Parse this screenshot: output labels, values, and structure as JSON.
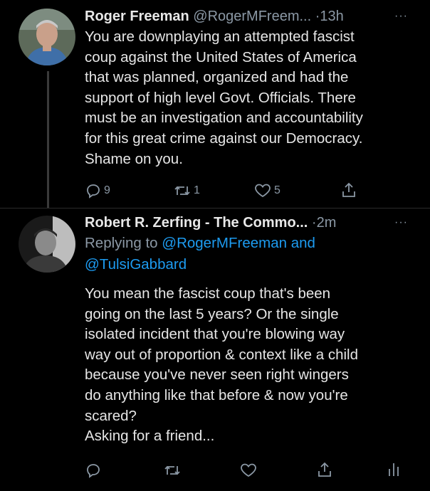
{
  "tweets": [
    {
      "author_name": "Roger Freeman",
      "handle": "@RogerMFreem...",
      "dot": "·",
      "time": "13h",
      "more": "···",
      "lines": [
        "You are downplaying an attempted fascist",
        "coup against the United States of America",
        "that was planned, organized and had the",
        "support of high level Govt. Officials.  There",
        "must be an investigation and accountability",
        "for this great crime against our Democracy.",
        "Shame on you."
      ],
      "actions": {
        "replies": "9",
        "retweets": "1",
        "likes": "5"
      }
    },
    {
      "author_name": "Robert R. Zerfing - The Commo...",
      "dot": "·",
      "time": "2m",
      "more": "···",
      "reply_prefix": "Replying to ",
      "reply_mention_1": "@RogerMFreeman and",
      "reply_mention_2": "@TulsiGabbard",
      "lines": [
        "You mean the fascist coup that's been",
        "going on the last 5 years? Or the single",
        "isolated incident that you're blowing way",
        "way out of proportion & context like a child",
        "because you've never seen right wingers",
        "do anything like that before & now you're",
        "scared?",
        "Asking for a friend..."
      ]
    }
  ],
  "icons": {
    "reply": "reply-icon",
    "retweet": "retweet-icon",
    "like": "heart-icon",
    "share": "share-icon",
    "analytics": "analytics-icon"
  },
  "colors": {
    "background": "#000000",
    "text": "#e6e6e6",
    "muted": "#8b98a5",
    "mention": "#1d9bf0"
  }
}
